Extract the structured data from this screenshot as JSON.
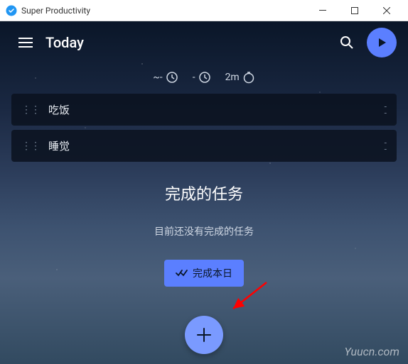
{
  "titlebar": {
    "app_name": "Super Productivity"
  },
  "header": {
    "title": "Today"
  },
  "time_summary": {
    "wave_prefix": "~-",
    "minus_prefix": "-",
    "timer_value": "2m"
  },
  "tasks": [
    {
      "name": "吃饭",
      "time": "-"
    },
    {
      "name": "睡觉",
      "time": "-"
    }
  ],
  "completed": {
    "section_title": "完成的任务",
    "empty_message": "目前还没有完成的任务"
  },
  "buttons": {
    "finish_day": "完成本日"
  },
  "watermark": "Yuucn.com",
  "colors": {
    "accent": "#5b7fff",
    "fab": "#7a9aff",
    "arrow": "#ff0000"
  }
}
